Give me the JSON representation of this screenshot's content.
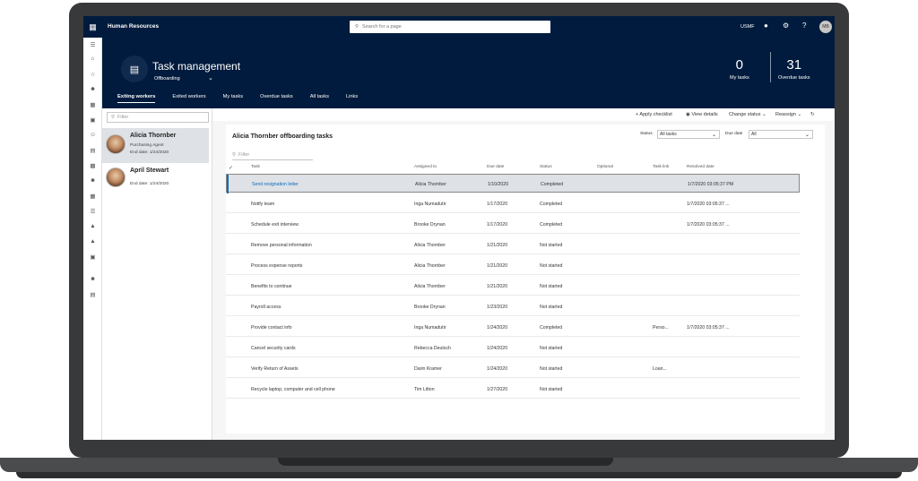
{
  "app": {
    "title": "Human Resources",
    "search_placeholder": "Search for a page",
    "company": "USMF",
    "user_initials": "MB"
  },
  "header": {
    "title": "Task management",
    "subtitle": "Offboarding",
    "stats": [
      {
        "value": "0",
        "label": "My tasks"
      },
      {
        "value": "31",
        "label": "Overdue tasks"
      }
    ],
    "tabs": [
      "Exiting workers",
      "Exited workers",
      "My tasks",
      "Overdue tasks",
      "All tasks",
      "Links"
    ]
  },
  "workers": {
    "filter_placeholder": "Filter",
    "items": [
      {
        "name": "Alicia Thornber",
        "role": "Purchasing Agent",
        "end_date": "End date: 1/24/2020"
      },
      {
        "name": "April Stewart",
        "role": "",
        "end_date": "End date: 1/24/2020"
      }
    ]
  },
  "actions": {
    "apply_checklist": "+ Apply checklist",
    "view_details": "View details",
    "change_status": "Change status",
    "reassign": "Reassign"
  },
  "tasks": {
    "title": "Alicia Thornber offboarding tasks",
    "status_label": "Status",
    "status_value": "All tasks",
    "due_label": "Due date",
    "due_value": "All",
    "filter_placeholder": "Filter",
    "columns": [
      "Task",
      "Assigned to",
      "Due date",
      "Status",
      "Optional",
      "Task link",
      "Resolved date"
    ],
    "rows": [
      {
        "task": "Send resignation letter",
        "assigned": "Alicia Thornber",
        "due": "1/10/2020",
        "status": "Completed",
        "optional": "",
        "link": "",
        "resolved": "1/7/2020 03:05:37 PM"
      },
      {
        "task": "Notify team",
        "assigned": "Inga Numadutir",
        "due": "1/17/2020",
        "status": "Completed",
        "optional": "",
        "link": "",
        "resolved": "1/7/2020 03:05:37 ..."
      },
      {
        "task": "Schedule exit interview",
        "assigned": "Brooke Drynan",
        "due": "1/17/2020",
        "status": "Completed",
        "optional": "",
        "link": "",
        "resolved": "1/7/2020 03:05:37 ..."
      },
      {
        "task": "Remove personal information",
        "assigned": "Alicia Thornber",
        "due": "1/21/2020",
        "status": "Not started",
        "optional": "",
        "link": "",
        "resolved": ""
      },
      {
        "task": "Process expense reports",
        "assigned": "Alicia Thornber",
        "due": "1/21/2020",
        "status": "Not started",
        "optional": "",
        "link": "",
        "resolved": ""
      },
      {
        "task": "Benefits to continue",
        "assigned": "Alicia Thornber",
        "due": "1/21/2020",
        "status": "Not started",
        "optional": "",
        "link": "",
        "resolved": ""
      },
      {
        "task": "Payroll access",
        "assigned": "Brooke Drynan",
        "due": "1/23/2020",
        "status": "Not started",
        "optional": "",
        "link": "",
        "resolved": ""
      },
      {
        "task": "Provide contact info",
        "assigned": "Inga Numadutir",
        "due": "1/24/2020",
        "status": "Completed",
        "optional": "",
        "link": "Perso...",
        "resolved": "1/7/2020 03:05:37 ..."
      },
      {
        "task": "Cancel security cards",
        "assigned": "Rebecca Deutsch",
        "due": "1/24/2020",
        "status": "Not started",
        "optional": "",
        "link": "",
        "resolved": ""
      },
      {
        "task": "Verify Return of Assets",
        "assigned": "Darin Kramer",
        "due": "1/24/2020",
        "status": "Not started",
        "optional": "",
        "link": "Loan...",
        "resolved": ""
      },
      {
        "task": "Recycle laptop, computer and cell phone",
        "assigned": "Tim Litton",
        "due": "1/27/2020",
        "status": "Not started",
        "optional": "",
        "link": "",
        "resolved": ""
      }
    ]
  }
}
